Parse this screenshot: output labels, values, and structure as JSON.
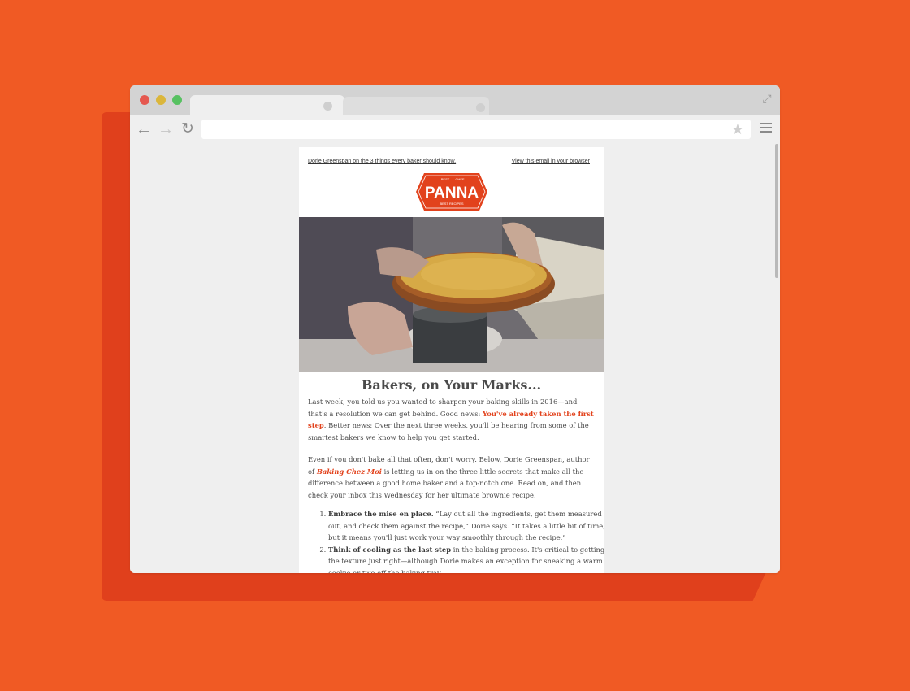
{
  "browser": {
    "url": "",
    "tabs": [
      "",
      ""
    ]
  },
  "email": {
    "preheader_left": "Dorie Greenspan on the 3 things every baker should know.",
    "preheader_right": "View this email in your browser",
    "logo": {
      "name": "PANNA",
      "tag_top_left": "BEST",
      "tag_top_right": "CHEF",
      "tag_bottom": "BEST RECIPES",
      "color": "#e2421c"
    },
    "headline": "Bakers, on Your Marks...",
    "p1": {
      "pre": "Last week, you told us you wanted to sharpen your baking skills in 2016—and that's a resolution we can get behind. Good news: ",
      "link": "You've already taken the first step",
      "post": ". Better news: Over the next three weeks, you'll be hearing from some of the smartest bakers we know to help you get started."
    },
    "p2": {
      "pre": "Even if you don't bake all that often, don't worry. Below, Dorie Greenspan, author of ",
      "link": "Baking Chez Moi",
      "post": " is letting us in on the three little secrets that make all the difference between a good home baker and a top-notch one. Read on, and then check your inbox this Wednesday for her ultimate brownie recipe."
    },
    "list": [
      {
        "bold": "Embrace the mise en place.",
        "text": " “Lay out all the ingredients, get them measured out, and check them against the recipe,” Dorie says. “It takes a little bit of time, but it means you'll just work your way smoothly through the recipe.”"
      },
      {
        "bold": "Think of cooling as the last step",
        "text": " in the baking process. It's critical to getting the texture just right—although Dorie makes an exception for sneaking a warm cookie or two off the baking tray."
      }
    ]
  },
  "colors": {
    "background": "#f05a24",
    "accent": "#e2421c"
  }
}
